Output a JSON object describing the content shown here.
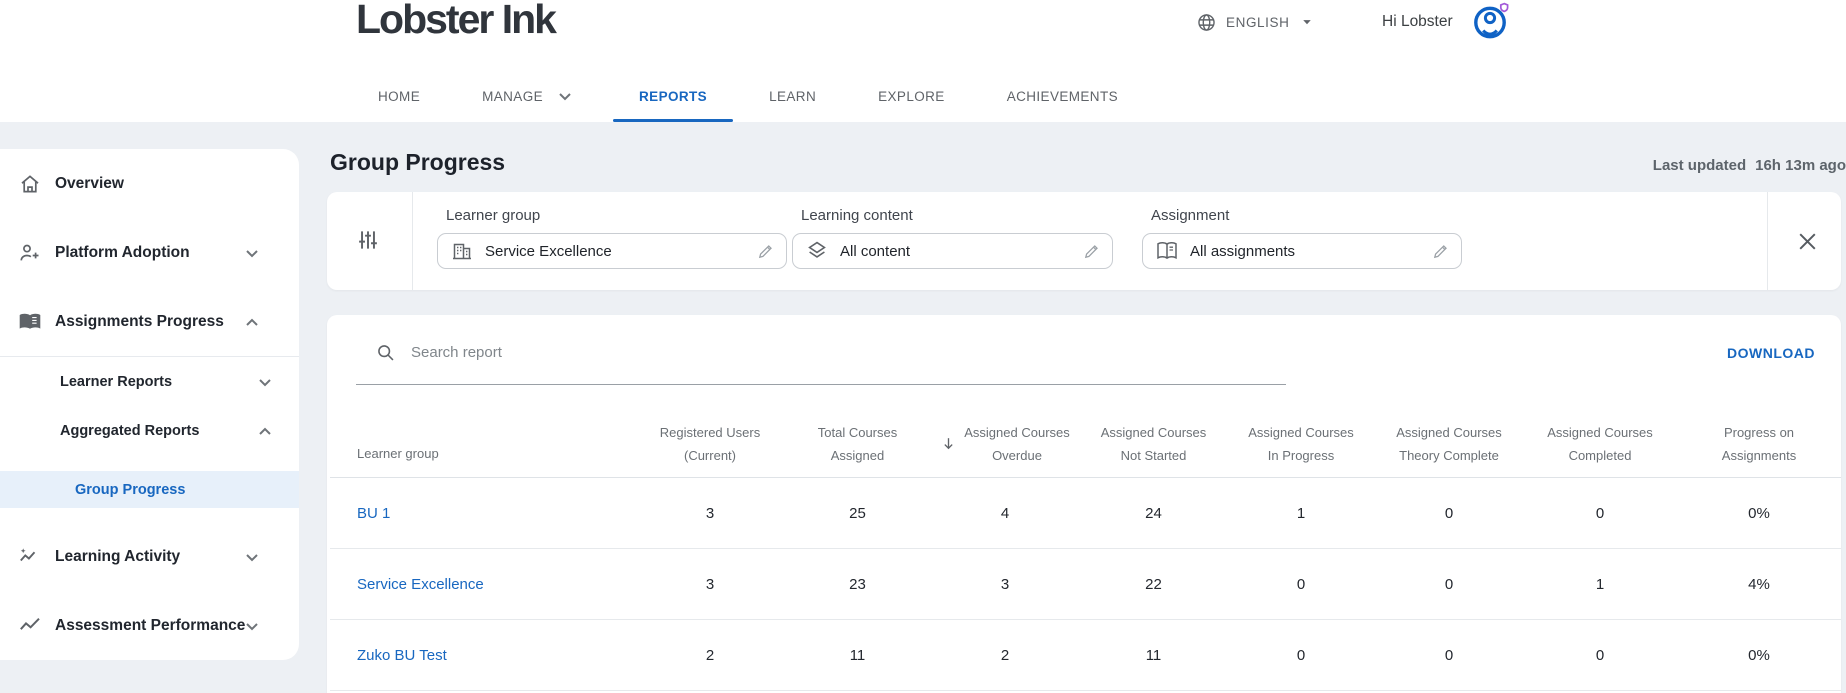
{
  "header": {
    "logo": "Lobster Ink",
    "language": "ENGLISH",
    "greeting": "Hi Lobster",
    "nav": [
      {
        "label": "HOME",
        "active": false,
        "has_dropdown": false
      },
      {
        "label": "MANAGE",
        "active": false,
        "has_dropdown": true
      },
      {
        "label": "REPORTS",
        "active": true,
        "has_dropdown": false
      },
      {
        "label": "LEARN",
        "active": false,
        "has_dropdown": false
      },
      {
        "label": "EXPLORE",
        "active": false,
        "has_dropdown": false
      },
      {
        "label": "ACHIEVEMENTS",
        "active": false,
        "has_dropdown": false
      }
    ]
  },
  "sidebar": {
    "items": [
      {
        "label": "Overview",
        "icon": "home",
        "chevron": null,
        "level": 0,
        "active": false,
        "divider_after": false
      },
      {
        "label": "Platform Adoption",
        "icon": "person-add",
        "chevron": "down",
        "level": 0,
        "active": false,
        "divider_after": false
      },
      {
        "label": "Assignments Progress",
        "icon": "book",
        "chevron": "up",
        "level": 0,
        "active": false,
        "divider_after": true
      },
      {
        "label": "Learner Reports",
        "icon": null,
        "chevron": "down",
        "level": 1,
        "active": false,
        "divider_after": false
      },
      {
        "label": "Aggregated Reports",
        "icon": null,
        "chevron": "up",
        "level": 1,
        "active": false,
        "divider_after": false
      },
      {
        "label": "Group Progress",
        "icon": null,
        "chevron": null,
        "level": 2,
        "active": true,
        "divider_after": false
      },
      {
        "label": "Learning Activity",
        "icon": "sparkline",
        "chevron": "down",
        "level": 0,
        "active": false,
        "divider_after": false
      },
      {
        "label": "Assessment Performance",
        "icon": "linechart",
        "chevron": "down",
        "level": 0,
        "active": false,
        "divider_after": false
      }
    ]
  },
  "page": {
    "title": "Group Progress",
    "last_updated_label": "Last updated",
    "last_updated_value": "16h 13m ago"
  },
  "filters": {
    "fields": [
      {
        "label": "Learner group",
        "value": "Service Excellence",
        "icon": "org"
      },
      {
        "label": "Learning content",
        "value": "All content",
        "icon": "layers"
      },
      {
        "label": "Assignment",
        "value": "All assignments",
        "icon": "book-open"
      }
    ]
  },
  "toolbar": {
    "search_placeholder": "Search report",
    "download_label": "DOWNLOAD"
  },
  "table": {
    "columns": [
      {
        "line1": "Learner group",
        "line2": "",
        "sorted": false
      },
      {
        "line1": "Registered Users",
        "line2": "(Current)",
        "sorted": false
      },
      {
        "line1": "Total Courses",
        "line2": "Assigned",
        "sorted": false
      },
      {
        "line1": "Assigned Courses",
        "line2": "Overdue",
        "sorted": true
      },
      {
        "line1": "Assigned Courses",
        "line2": "Not Started",
        "sorted": false
      },
      {
        "line1": "Assigned Courses",
        "line2": "In Progress",
        "sorted": false
      },
      {
        "line1": "Assigned Courses",
        "line2": "Theory Complete",
        "sorted": false
      },
      {
        "line1": "Assigned Courses",
        "line2": "Completed",
        "sorted": false
      },
      {
        "line1": "Progress on",
        "line2": "Assignments",
        "sorted": false
      }
    ],
    "rows": [
      {
        "group": "BU 1",
        "values": [
          "3",
          "25",
          "4",
          "24",
          "1",
          "0",
          "0",
          "0%"
        ]
      },
      {
        "group": "Service Excellence",
        "values": [
          "3",
          "23",
          "3",
          "22",
          "0",
          "0",
          "1",
          "4%"
        ]
      },
      {
        "group": "Zuko BU Test",
        "values": [
          "2",
          "11",
          "2",
          "11",
          "0",
          "0",
          "0",
          "0%"
        ]
      }
    ]
  },
  "colors": {
    "accent": "#1867c0",
    "page_background": "#edf0f4",
    "active_item_background": "#e7f0fa",
    "link": "#1867c0",
    "muted_text": "#6b7075"
  }
}
